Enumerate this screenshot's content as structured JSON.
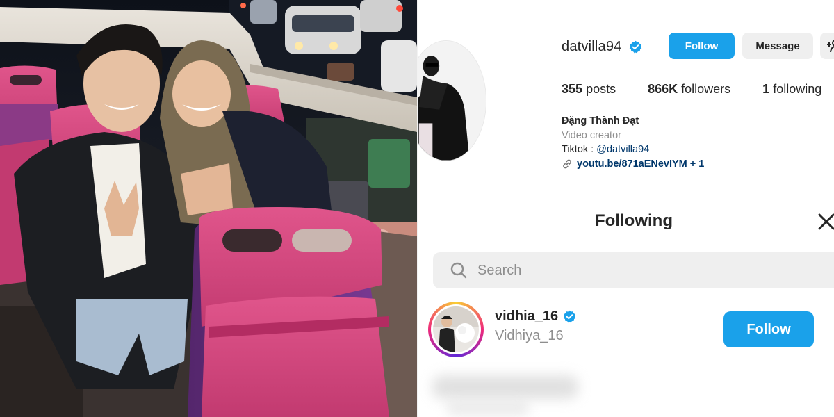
{
  "profile": {
    "username": "datvilla94",
    "verified": true,
    "follow_label": "Follow",
    "message_label": "Message",
    "posts_count": "355",
    "posts_label": "posts",
    "followers_count": "866K",
    "followers_label": "followers",
    "following_count": "1",
    "following_label": "following",
    "full_name": "Đặng Thành Đạt",
    "category": "Video creator",
    "bio_prefix": "Tiktok : ",
    "bio_mention": "@datvilla94",
    "link_text": "youtu.be/871aENevIYM + 1"
  },
  "following_modal": {
    "title": "Following",
    "search_placeholder": "Search",
    "items": [
      {
        "username": "vidhia_16",
        "verified": true,
        "full_name": "Vidhiya_16",
        "follow_label": "Follow"
      }
    ]
  },
  "icons": {
    "verified": "verified-badge-icon",
    "add_user": "add-person-icon",
    "link": "link-icon",
    "close": "close-icon",
    "search": "search-icon"
  },
  "colors": {
    "accent_blue": "#1aa1ea",
    "secondary_button": "#efefef",
    "muted_text": "#8e8e8e",
    "link_text": "#00376b",
    "bus_seat_pink": "#d9417a",
    "bus_seat_purple": "#6a2f84"
  }
}
